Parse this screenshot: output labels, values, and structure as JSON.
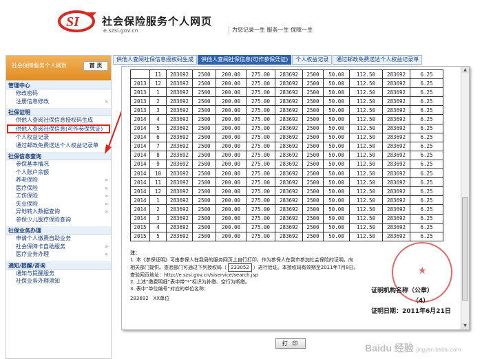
{
  "header": {
    "title": "社会保险服务个人网页",
    "url": "e.szsi.gov.cn",
    "slogan": "为您记录一生  服务一生  保障一生"
  },
  "sidebar": {
    "head_label": "社会保障服务个人网页",
    "home_label": "首 页",
    "sections": [
      {
        "title": "管理中心",
        "items": [
          {
            "label": "修改密码",
            "arrow": false
          },
          {
            "label": "注册信息修改",
            "arrow": true
          }
        ]
      },
      {
        "title": "社保证明",
        "items": [
          {
            "label": "供他人查阅社保信息授权码生成",
            "arrow": false
          },
          {
            "label": "供他人查阅社保信息(可作参保凭证)",
            "arrow": false,
            "highlight": true
          },
          {
            "label": "个人权益记录",
            "arrow": false
          },
          {
            "label": "通过邮政免费送达个人权益记录单",
            "arrow": false
          }
        ]
      },
      {
        "title": "社保信息查询",
        "items": [
          {
            "label": "参保基本情况",
            "arrow": false
          },
          {
            "label": "个人账户余额",
            "arrow": false
          },
          {
            "label": "养老保险",
            "arrow": true
          },
          {
            "label": "医疗保险",
            "arrow": true
          },
          {
            "label": "工伤保险",
            "arrow": true
          },
          {
            "label": "失业保险",
            "arrow": true
          },
          {
            "label": "异地转入数据查询",
            "arrow": true
          },
          {
            "label": "参保少儿医疗保险查询",
            "arrow": false
          }
        ]
      },
      {
        "title": "社保业务办理",
        "items": [
          {
            "label": "申请个人缴费自助业务",
            "arrow": false
          },
          {
            "label": "社会保障卡自助服务",
            "arrow": true
          },
          {
            "label": "医疗业务办理",
            "arrow": true
          }
        ]
      },
      {
        "title": "通知/提醒/咨询",
        "items": [
          {
            "label": "通知与提醒服务",
            "arrow": false
          },
          {
            "label": "社保业务办理须知",
            "arrow": false
          }
        ]
      }
    ]
  },
  "tabs": [
    {
      "label": "供他人查阅社保信息授权码生成",
      "active": false
    },
    {
      "label": "供他人查阅社保信息(可作参保凭证)",
      "active": true
    },
    {
      "label": "个人权益记录",
      "active": false
    },
    {
      "label": "通过邮政免费送达个人权益记录单",
      "active": false
    }
  ],
  "table_rows": [
    [
      "",
      "11",
      "283692",
      "2500",
      "200.00",
      "275.00",
      "283692",
      "2500",
      "50.00",
      "112.50",
      "283692",
      "6.25"
    ],
    [
      "2013",
      "12",
      "283692",
      "2500",
      "200.00",
      "275.00",
      "283692",
      "2500",
      "50.00",
      "112.50",
      "283692",
      "6.25"
    ],
    [
      "2013",
      "1",
      "283692",
      "2500",
      "200.00",
      "275.00",
      "283692",
      "2500",
      "50.00",
      "112.50",
      "283692",
      "6.25"
    ],
    [
      "2013",
      "2",
      "283692",
      "2500",
      "200.00",
      "275.00",
      "283692",
      "2500",
      "50.00",
      "112.50",
      "283692",
      "6.25"
    ],
    [
      "2013",
      "3",
      "283692",
      "2500",
      "200.00",
      "275.00",
      "283692",
      "2500",
      "50.00",
      "112.50",
      "283692",
      "6.25"
    ],
    [
      "2014",
      "4",
      "283692",
      "2500",
      "200.00",
      "275.00",
      "283692",
      "2500",
      "50.00",
      "112.50",
      "283692",
      "6.25"
    ],
    [
      "2014",
      "5",
      "283692",
      "2500",
      "200.00",
      "275.00",
      "283692",
      "2500",
      "50.00",
      "112.50",
      "283692",
      "6.25"
    ],
    [
      "2014",
      "6",
      "283692",
      "2500",
      "200.00",
      "275.00",
      "283692",
      "2500",
      "50.00",
      "112.50",
      "283692",
      "6.25"
    ],
    [
      "2014",
      "7",
      "283692",
      "2500",
      "200.00",
      "275.00",
      "283692",
      "2500",
      "50.00",
      "112.50",
      "283692",
      "6.25"
    ],
    [
      "2014",
      "8",
      "283692",
      "2500",
      "200.00",
      "275.00",
      "283692",
      "2500",
      "50.00",
      "112.50",
      "283692",
      "6.25"
    ],
    [
      "2014",
      "9",
      "283692",
      "2500",
      "200.00",
      "275.00",
      "283692",
      "2500",
      "50.00",
      "112.50",
      "283692",
      "6.25"
    ],
    [
      "2014",
      "10",
      "283692",
      "2500",
      "200.00",
      "275.00",
      "283692",
      "2500",
      "50.00",
      "112.50",
      "283692",
      "6.25"
    ],
    [
      "2014",
      "11",
      "283692",
      "2500",
      "200.00",
      "275.00",
      "283692",
      "2500",
      "50.00",
      "112.50",
      "283692",
      "6.25"
    ],
    [
      "2014",
      "12",
      "283692",
      "2500",
      "200.00",
      "275.00",
      "283692",
      "2500",
      "50.00",
      "112.50",
      "283692",
      "6.25"
    ],
    [
      "2014",
      "1",
      "283692",
      "2500",
      "200.00",
      "275.00",
      "283692",
      "2500",
      "50.00",
      "112.50",
      "283692",
      "6.25"
    ],
    [
      "2014",
      "2",
      "283692",
      "2500",
      "200.00",
      "275.00",
      "283692",
      "2500",
      "50.00",
      "112.50",
      "283692",
      "6.25"
    ],
    [
      "2014",
      "3",
      "283692",
      "2500",
      "200.00",
      "275.00",
      "283692",
      "2500",
      "50.00",
      "112.50",
      "283692",
      "6.25"
    ],
    [
      "2015",
      "4",
      "283692",
      "2500",
      "200.00",
      "275.00",
      "283692",
      "2500",
      "50.00",
      "112.50",
      "283692",
      "6.25"
    ],
    [
      "2015",
      "5",
      "283692",
      "2500",
      "200.00",
      "275.00",
      "283692",
      "2500",
      "50.00",
      "112.50",
      "283692",
      "6.25"
    ]
  ],
  "notes": {
    "heading": "注：",
    "line1": "1. 本《参保证明》可由参保人在我局的服务网页上自行打印，作为参保人在我市参加社会保险的证明。向",
    "line2a": "相关部门提供。查验部门可通过下列授权码（",
    "auth_code": "233052",
    "line2b": "）进行验证。本授权码有效期至2011年7月8日。",
    "line3": "查验网页地址：http://e.szsi.gov.cn/siservice/search.jsp",
    "line4": "2. 上述“缴费明细”表中带“*”标识为补缴、空行为断缴。",
    "line5": "3. 表中“单位编号”对应的单位名称：",
    "unit_code": "283692",
    "unit_name": "XX单位"
  },
  "certificate": {
    "org_label": "证明机构名称（公章）",
    "org_value": "（4）",
    "date_label": "证明日期：2011年6月21日"
  },
  "print_label": "打 印",
  "watermark": "Baidu 经验",
  "watermark_sub": "jingyan.baidu.com"
}
